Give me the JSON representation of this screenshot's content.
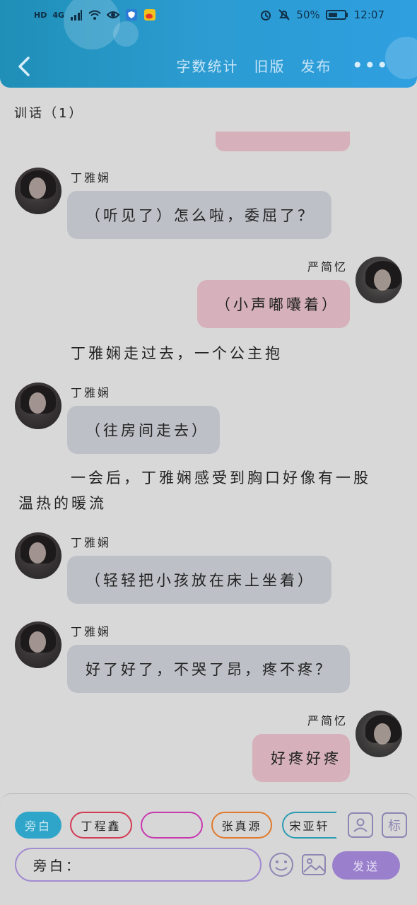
{
  "status_bar": {
    "hd": "HD",
    "net": "4G",
    "battery": "50%",
    "time": "12:07"
  },
  "header": {
    "actions": [
      "字数统计",
      "旧版",
      "发布"
    ],
    "more": "•••"
  },
  "subtitle": "训话（1）",
  "messages": [
    {
      "type": "left",
      "name": "丁雅娴",
      "text": "（听见了）怎么啦，委屈了？"
    },
    {
      "type": "right",
      "name": "严简忆",
      "text": "（小声嘟囔着）"
    },
    {
      "type": "narration",
      "text": "丁雅娴走过去，一个公主抱"
    },
    {
      "type": "left",
      "name": "丁雅娴",
      "text": "（往房间走去）"
    },
    {
      "type": "narration",
      "text_line1": "一会后，丁雅娴感受到胸口好像有一股",
      "text_line2": "温热的暖流"
    },
    {
      "type": "left",
      "name": "丁雅娴",
      "text": "（轻轻把小孩放在床上坐着）"
    },
    {
      "type": "left",
      "name": "丁雅娴",
      "text": "好了好了，不哭了昂，疼不疼？"
    },
    {
      "type": "right",
      "name": "严简忆",
      "text": "好疼好疼"
    }
  ],
  "bottom": {
    "chips": [
      "旁白",
      "丁程鑫",
      "",
      "张真源",
      "宋亚轩"
    ],
    "tag_button": "标",
    "input_value": "旁白：",
    "send": "发送"
  },
  "colors": {
    "header": "#2b9bd0",
    "left_bubble": "#bdc1c7",
    "right_bubble": "#d6b1bb",
    "active_chip": "#2fa6c9",
    "send": "#9a7fcc"
  }
}
